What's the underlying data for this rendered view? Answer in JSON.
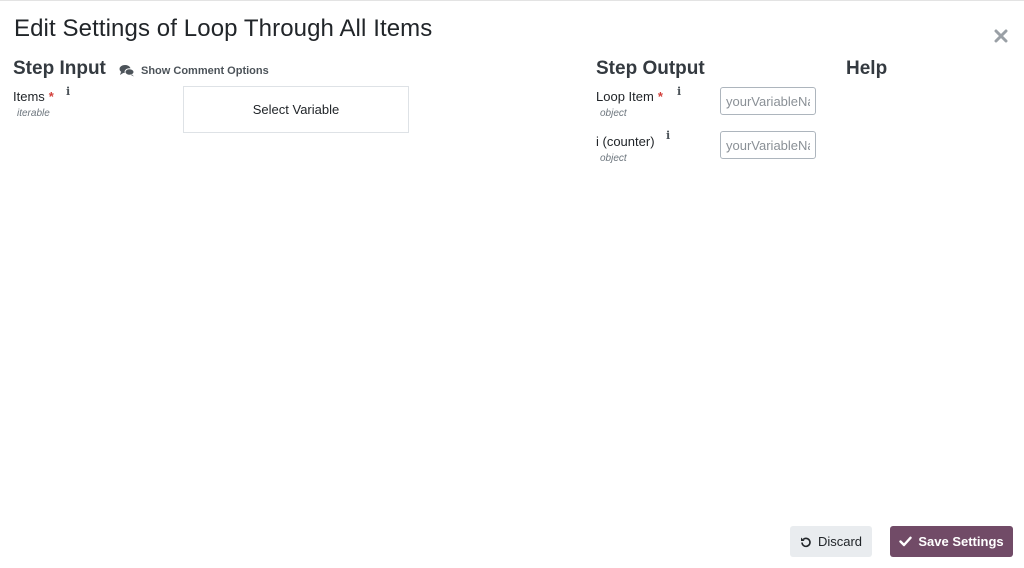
{
  "dialog": {
    "title": "Edit Settings of Loop Through All Items"
  },
  "step_input": {
    "heading": "Step Input",
    "comment_options_label": "Show Comment Options",
    "fields": [
      {
        "label": "Items",
        "type": "iterable",
        "required": true,
        "button_label": "Select Variable"
      }
    ]
  },
  "step_output": {
    "heading": "Step Output",
    "fields": [
      {
        "label": "Loop Item",
        "type": "object",
        "required": true,
        "placeholder": "yourVariableName",
        "value": ""
      },
      {
        "label": "i (counter)",
        "type": "object",
        "required": false,
        "placeholder": "yourVariableName",
        "value": ""
      }
    ]
  },
  "help": {
    "heading": "Help"
  },
  "footer": {
    "discard_label": "Discard",
    "save_label": "Save Settings"
  },
  "icons": {
    "close": "close-icon",
    "comments": "comments-icon",
    "info": "info-icon",
    "discard": "undo-icon",
    "save": "check-icon"
  },
  "colors": {
    "primary": "#714b67",
    "required": "#d23f3a",
    "secondary_button": "#e9ecef"
  }
}
